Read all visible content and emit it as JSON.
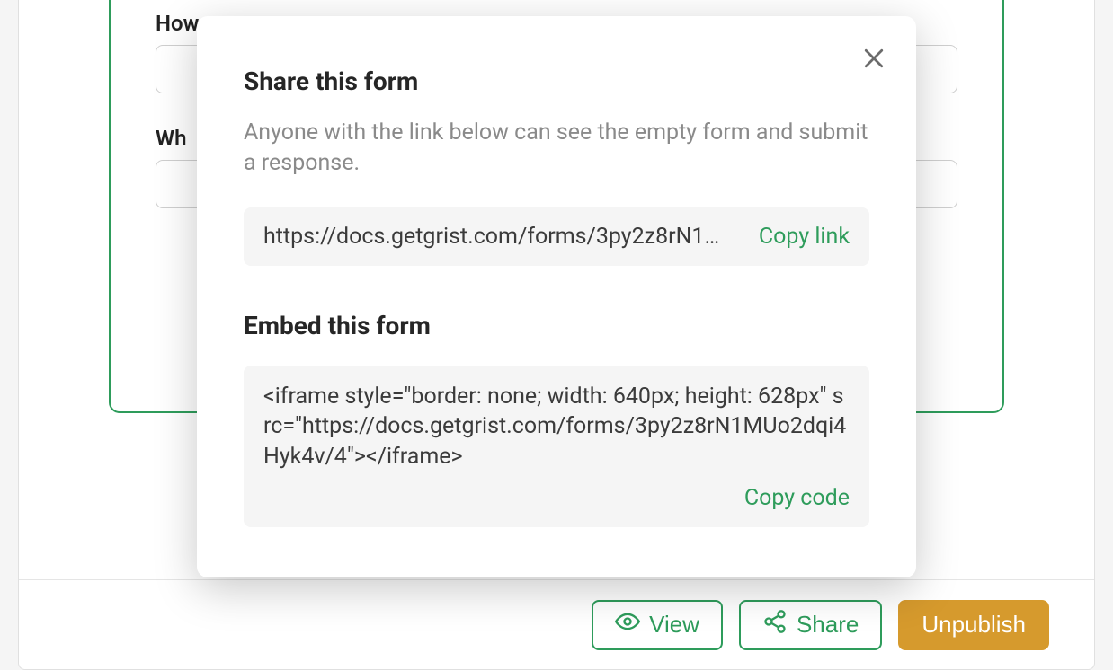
{
  "background": {
    "field1": {
      "label": "How"
    },
    "field2": {
      "label": "Wh"
    }
  },
  "footer": {
    "view_label": "View",
    "share_label": "Share",
    "unpublish_label": "Unpublish"
  },
  "modal": {
    "share_heading": "Share this form",
    "share_subtext": "Anyone with the link below can see the empty form and submit a response.",
    "share_url_display": "https://docs.getgrist.com/forms/3py2z8rN1…",
    "copy_link_label": "Copy link",
    "embed_heading": "Embed this form",
    "embed_code": "<iframe style=\"border: none; width: 640px; height: 628px\" src=\"https://docs.getgrist.com/forms/3py2z8rN1MUo2dqi4Hyk4v/4\"></iframe>",
    "copy_code_label": "Copy code"
  }
}
